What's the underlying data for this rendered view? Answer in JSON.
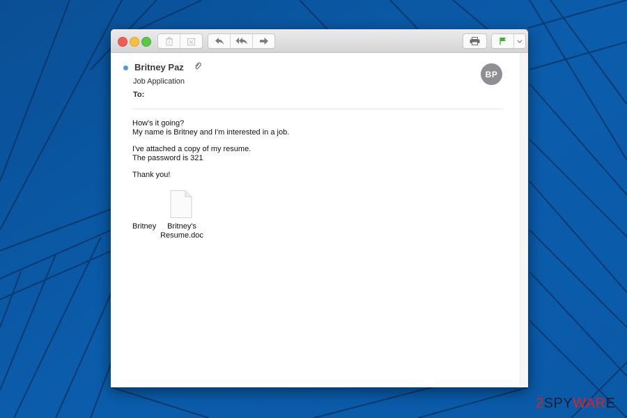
{
  "window": {
    "traffic_lights": [
      "close",
      "minimize",
      "maximize"
    ],
    "toolbar": {
      "left_group_1": [
        {
          "name": "delete",
          "icon": "trash-icon"
        },
        {
          "name": "junk",
          "icon": "junk-icon"
        }
      ],
      "left_group_2": [
        {
          "name": "reply",
          "icon": "reply-icon"
        },
        {
          "name": "reply-all",
          "icon": "reply-all-icon"
        },
        {
          "name": "forward",
          "icon": "forward-icon"
        }
      ],
      "right_group_1": [
        {
          "name": "print",
          "icon": "printer-icon"
        }
      ],
      "right_group_2": [
        {
          "name": "flag",
          "icon": "flag-icon",
          "color": "#3eb33a"
        },
        {
          "name": "flag-menu",
          "icon": "chevron-down-icon"
        }
      ]
    }
  },
  "message": {
    "sender": "Britney Paz",
    "unread_dot_color": "#4b9be3",
    "has_attachment": true,
    "subject": "Job Application",
    "to_label": "To:",
    "avatar_initials": "BP",
    "avatar_color": "#8e8e93",
    "body": {
      "line1": "How's it going?",
      "line2": "My name is Britney and I'm interested in a job.",
      "line3": "I've attached a copy of my resume.",
      "line4": "The password is 321",
      "line5": "Thank you!"
    },
    "signature": "Britney",
    "attachment": {
      "name_line1": "Britney's",
      "name_line2": "Resume.doc"
    }
  },
  "watermark": {
    "part1": "2",
    "part2": "SPY",
    "part3": "WAR",
    "part4": "E"
  }
}
